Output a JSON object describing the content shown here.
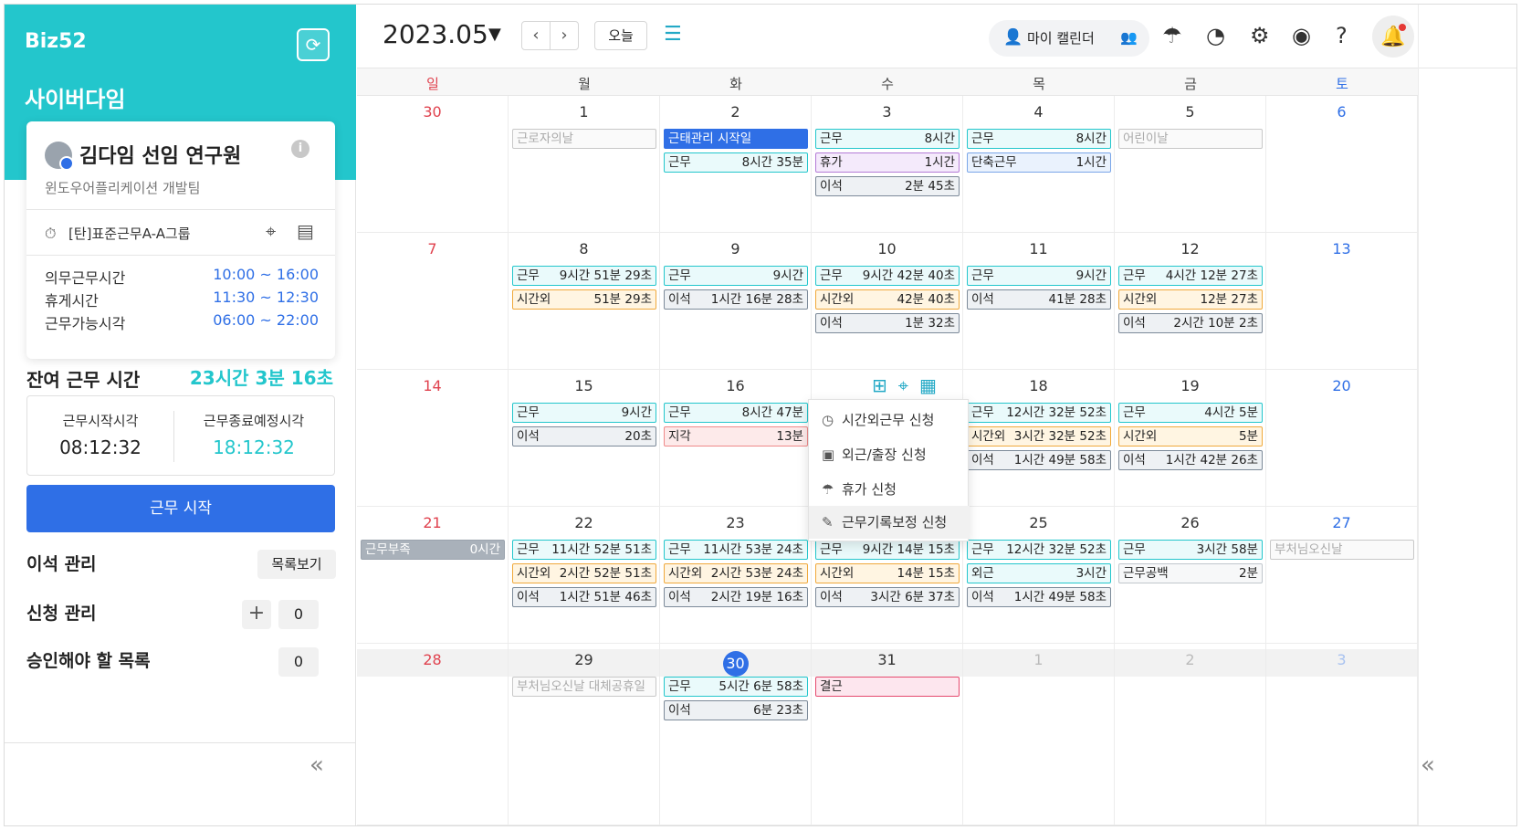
{
  "sidebar": {
    "logo": "Biz52",
    "company": "사이버다임",
    "profile": {
      "name": "김다임 선임 연구원",
      "team": "윈도우어플리케이션 개발팀",
      "group": "[탄]표준근무A-A그룹"
    },
    "schedule": [
      {
        "label": "의무근무시간",
        "value": "10:00 ~ 16:00"
      },
      {
        "label": "휴게시간",
        "value": "11:30 ~ 12:30"
      },
      {
        "label": "근무가능시각",
        "value": "06:00 ~ 22:00"
      }
    ],
    "remaining_label": "잔여 근무 시간",
    "remaining_value": "23시간 3분 16초",
    "start_label": "근무시작시각",
    "start_value": "08:12:32",
    "end_label": "근무종료예정시각",
    "end_value": "18:12:32",
    "start_button": "근무 시작",
    "away_label": "이석 관리",
    "list_button": "목록보기",
    "request_label": "신청 관리",
    "request_count": "0",
    "approve_label": "승인해야 할 목록",
    "approve_count": "0"
  },
  "topbar": {
    "date": "2023.05",
    "today": "오늘",
    "my_calendar": "마이 캘린더"
  },
  "weekdays": [
    "일",
    "월",
    "화",
    "수",
    "목",
    "금",
    "토"
  ],
  "weeks": [
    [
      "30",
      "1",
      "2",
      "3",
      "4",
      "5",
      "6"
    ],
    [
      "7",
      "8",
      "9",
      "10",
      "11",
      "12",
      "13"
    ],
    [
      "14",
      "15",
      "16",
      "",
      "18",
      "19",
      "20"
    ],
    [
      "21",
      "22",
      "23",
      "",
      "25",
      "26",
      "27"
    ],
    [
      "28",
      "29",
      "30",
      "31",
      "1",
      "2",
      "3"
    ]
  ],
  "events": {
    "w1": {
      "mon": [
        {
          "l": "근로자의날",
          "r": ""
        }
      ],
      "tue": [
        {
          "l": "근태관리 시작일",
          "r": ""
        },
        {
          "l": "근무",
          "r": "8시간 35분"
        }
      ],
      "wed": [
        {
          "l": "근무",
          "r": "8시간"
        },
        {
          "l": "휴가",
          "r": "1시간"
        },
        {
          "l": "이석",
          "r": "2분 45초"
        }
      ],
      "thu": [
        {
          "l": "근무",
          "r": "8시간"
        },
        {
          "l": "단축근무",
          "r": "1시간"
        }
      ],
      "fri": [
        {
          "l": "어린이날",
          "r": ""
        }
      ]
    },
    "w2": {
      "mon": [
        {
          "l": "근무",
          "r": "9시간 51분 29초"
        },
        {
          "l": "시간외",
          "r": "51분 29초"
        }
      ],
      "tue": [
        {
          "l": "근무",
          "r": "9시간"
        },
        {
          "l": "이석",
          "r": "1시간 16분 28초"
        }
      ],
      "wed": [
        {
          "l": "근무",
          "r": "9시간 42분 40초"
        },
        {
          "l": "시간외",
          "r": "42분 40초"
        },
        {
          "l": "이석",
          "r": "1분 32초"
        }
      ],
      "thu": [
        {
          "l": "근무",
          "r": "9시간"
        },
        {
          "l": "이석",
          "r": "41분 28초"
        }
      ],
      "fri": [
        {
          "l": "근무",
          "r": "4시간 12분 27초"
        },
        {
          "l": "시간외",
          "r": "12분 27초"
        },
        {
          "l": "이석",
          "r": "2시간 10분 2초"
        }
      ]
    },
    "w3": {
      "mon": [
        {
          "l": "근무",
          "r": "9시간"
        },
        {
          "l": "이석",
          "r": "20초"
        }
      ],
      "tue": [
        {
          "l": "근무",
          "r": "8시간 47분"
        },
        {
          "l": "지각",
          "r": "13분"
        }
      ],
      "thu": [
        {
          "l": "근무",
          "r": "12시간 32분 52초"
        },
        {
          "l": "시간외",
          "r": "3시간 32분 52초"
        },
        {
          "l": "이석",
          "r": "1시간 49분 58초"
        }
      ],
      "fri": [
        {
          "l": "근무",
          "r": "4시간 5분"
        },
        {
          "l": "시간외",
          "r": "5분"
        },
        {
          "l": "이석",
          "r": "1시간 42분 26초"
        }
      ]
    },
    "w4": {
      "sun": [
        {
          "l": "근무부족",
          "r": "0시간"
        }
      ],
      "mon": [
        {
          "l": "근무",
          "r": "11시간 52분 51초"
        },
        {
          "l": "시간외",
          "r": "2시간 52분 51초"
        },
        {
          "l": "이석",
          "r": "1시간 51분 46초"
        }
      ],
      "tue": [
        {
          "l": "근무",
          "r": "11시간 53분 24초"
        },
        {
          "l": "시간외",
          "r": "2시간 53분 24초"
        },
        {
          "l": "이석",
          "r": "2시간 19분 16초"
        }
      ],
      "wed": [
        {
          "l": "근무",
          "r": "9시간 14분 15초"
        },
        {
          "l": "시간외",
          "r": "14분 15초"
        },
        {
          "l": "이석",
          "r": "3시간 6분 37초"
        }
      ],
      "thu": [
        {
          "l": "근무",
          "r": "12시간 32분 52초"
        },
        {
          "l": "외근",
          "r": "3시간"
        },
        {
          "l": "이석",
          "r": "1시간 49분 58초"
        }
      ],
      "fri": [
        {
          "l": "근무",
          "r": "3시간 58분"
        },
        {
          "l": "근무공백",
          "r": "2분"
        }
      ],
      "sat": [
        {
          "l": "부처님오신날",
          "r": ""
        }
      ]
    },
    "w5": {
      "mon": [
        {
          "l": "부처님오신날 대체공휴일",
          "r": ""
        }
      ],
      "tue": [
        {
          "l": "근무",
          "r": "5시간 6분 58초"
        },
        {
          "l": "이석",
          "r": "6분 23초"
        }
      ],
      "wed": [
        {
          "l": "결근",
          "r": ""
        }
      ]
    }
  },
  "context_menu": [
    "시간외근무 신청",
    "외근/출장 신청",
    "휴가 신청",
    "근무기록보정 신청"
  ],
  "colors": {
    "teal": "#23c6cc",
    "blue": "#2f6fe6",
    "sunday": "#e0424e",
    "saturday": "#2f6fe6"
  }
}
